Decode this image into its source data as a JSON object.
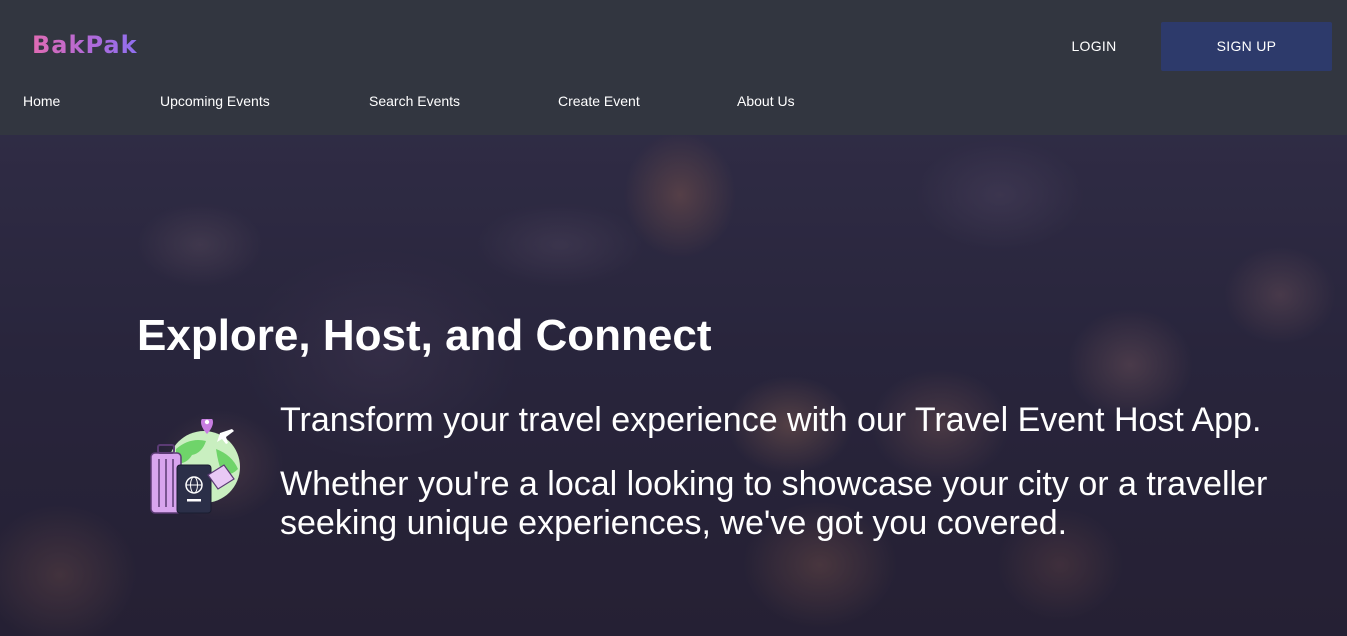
{
  "app": {
    "logo": "BakPak"
  },
  "header": {
    "login_label": "LOGIN",
    "signup_label": "SIGN UP"
  },
  "nav": {
    "items": [
      {
        "label": "Home"
      },
      {
        "label": "Upcoming Events"
      },
      {
        "label": "Search Events"
      },
      {
        "label": "Create Event"
      },
      {
        "label": "About Us"
      }
    ]
  },
  "hero": {
    "title": "Explore, Host, and Connect",
    "line1": "Transform your travel experience with our Travel Event Host App.",
    "line2": "Whether you're a local looking to showcase your city or a traveller seeking unique experiences, we've got you covered.",
    "icon": "travel-passport-luggage-icon",
    "background": "concert-crowd-photo"
  },
  "colors": {
    "header_bg": "#323640",
    "signup_bg": "#2d3a6b",
    "logo_gradient_start": "#e06bb3",
    "logo_gradient_end": "#8f6ff0"
  }
}
